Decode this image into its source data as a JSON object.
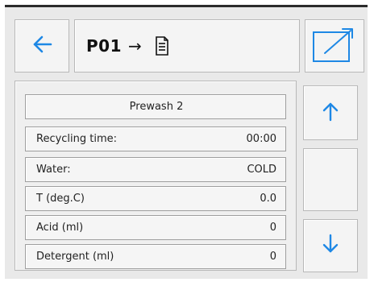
{
  "header": {
    "program": "P01",
    "arrow": "→",
    "back_icon": "arrow-left-icon",
    "document_icon": "document-icon",
    "export_icon": "export-icon"
  },
  "panel": {
    "title": "Prewash 2",
    "rows": [
      {
        "label": "Recycling time:",
        "value": "00:00"
      },
      {
        "label": "Water:",
        "value": "COLD"
      },
      {
        "label": "T (deg.C)",
        "value": "0.0"
      },
      {
        "label": "Acid (ml)",
        "value": "0"
      },
      {
        "label": "Detergent (ml)",
        "value": "0"
      }
    ]
  },
  "scroll": {
    "up_icon": "arrow-up-icon",
    "down_icon": "arrow-down-icon"
  },
  "colors": {
    "accent": "#1e88e5",
    "background": "#e9e9e9",
    "border": "#9e9e9e"
  }
}
